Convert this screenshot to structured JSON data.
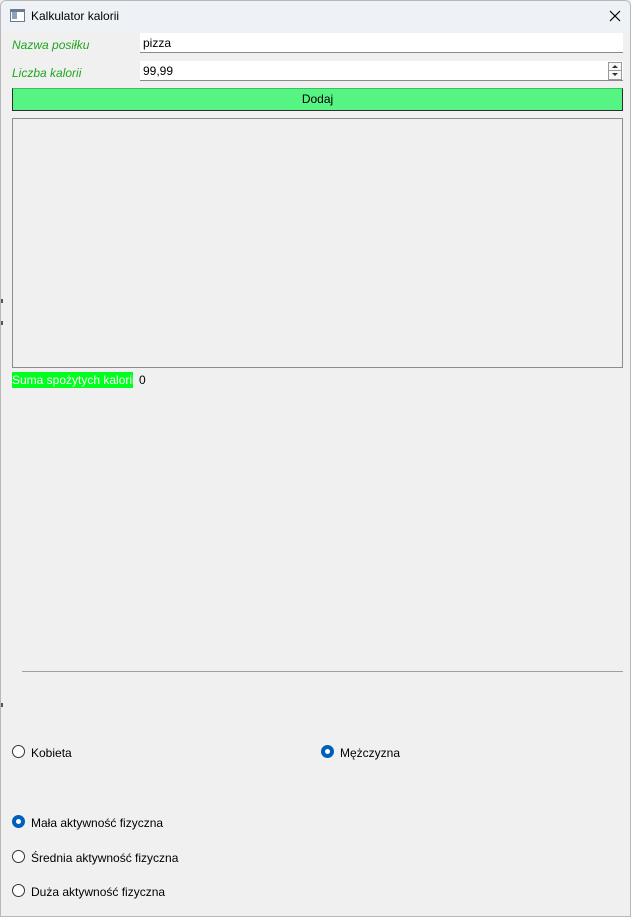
{
  "window": {
    "title": "Kalkulator kalorii"
  },
  "form": {
    "meal_label": "Nazwa posiłku",
    "meal_value": "pizza",
    "calories_label": "Liczba kalorii",
    "calories_value": "99,99",
    "add_button": "Dodaj"
  },
  "summary": {
    "label": "Suma spożytych kalorii",
    "value": "0"
  },
  "gender": {
    "options": [
      {
        "label": "Kobieta",
        "checked": false
      },
      {
        "label": "Mężczyzna",
        "checked": true
      }
    ]
  },
  "activity": {
    "options": [
      {
        "label": "Mała aktywność fizyczna",
        "checked": true
      },
      {
        "label": "Średnia aktywność fizyczna",
        "checked": false
      },
      {
        "label": "Duża aktywność fizyczna",
        "checked": false
      }
    ]
  },
  "colors": {
    "label_green": "#1fa61f",
    "button_green": "#56f482",
    "sum_highlight": "#00ff1e",
    "radio_accent": "#005fb8"
  }
}
